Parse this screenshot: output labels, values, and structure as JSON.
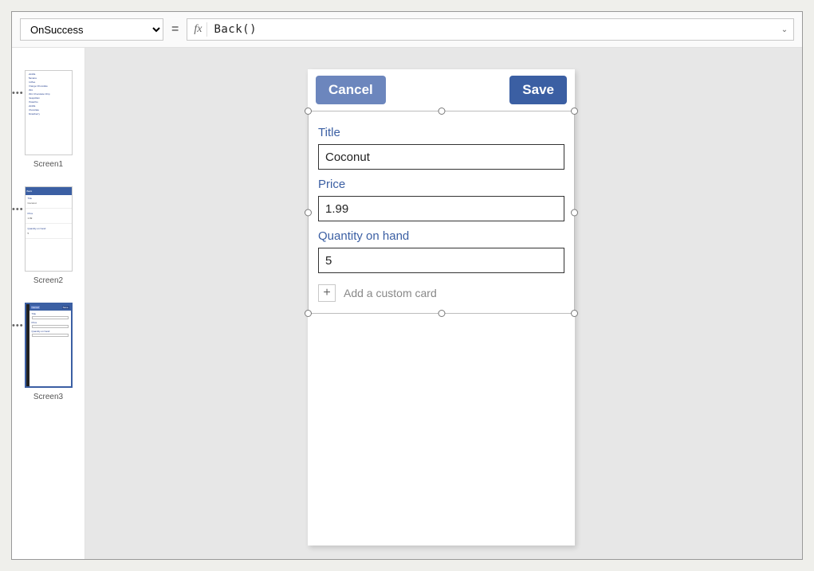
{
  "formulaBar": {
    "property": "OnSuccess",
    "equals": "=",
    "fx": "fx",
    "formula": "Back()"
  },
  "treeview": {
    "screens": [
      {
        "label": "Screen1"
      },
      {
        "label": "Screen2"
      },
      {
        "label": "Screen3"
      }
    ]
  },
  "app": {
    "buttons": {
      "cancel": "Cancel",
      "save": "Save"
    },
    "fields": {
      "title": {
        "label": "Title",
        "value": "Coconut"
      },
      "price": {
        "label": "Price",
        "value": "1.99"
      },
      "qty": {
        "label": "Quantity on hand",
        "value": "5"
      }
    },
    "addCard": "Add a custom card",
    "plus": "+"
  },
  "thumbs": {
    "t1": [
      "Vanilla",
      "Banana",
      "Coffee",
      "Orange Chocolate",
      "Mint",
      "Mint Chocolate Chip",
      "Neapolitan",
      "Pistachio",
      "Vanilla",
      "Chocolate",
      "Strawberry"
    ],
    "t2": {
      "back": "Back",
      "lines": [
        "Title",
        "Coconut",
        "Price",
        "1.99",
        "Quantity on hand",
        "5"
      ]
    },
    "t3": {
      "cancel": "Cancel",
      "save": "Save",
      "lines": [
        "Title",
        "Price",
        "Quantity on hand"
      ]
    }
  }
}
